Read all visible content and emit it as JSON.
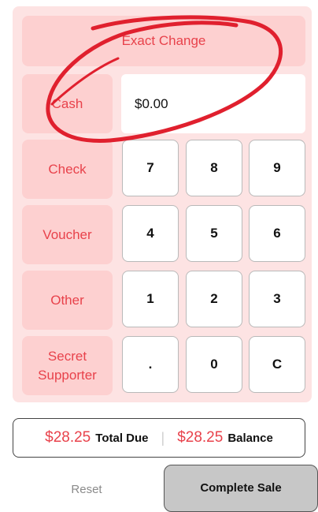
{
  "exact_change": {
    "label": "Exact Change"
  },
  "payment_methods": [
    {
      "name": "cash",
      "label": "Cash"
    },
    {
      "name": "check",
      "label": "Check"
    },
    {
      "name": "voucher",
      "label": "Voucher"
    },
    {
      "name": "other",
      "label": "Other"
    },
    {
      "name": "secret-supporter",
      "label": "Secret\nSupporter"
    }
  ],
  "amount_display": {
    "value": "$0.00"
  },
  "keypad": [
    [
      "7",
      "8",
      "9"
    ],
    [
      "4",
      "5",
      "6"
    ],
    [
      "1",
      "2",
      "3"
    ],
    [
      ".",
      "0",
      "C"
    ]
  ],
  "summary": {
    "total_due_amount": "$28.25",
    "total_due_label": "Total Due",
    "separator": "|",
    "balance_amount": "$28.25",
    "balance_label": "Balance"
  },
  "actions": {
    "reset": "Reset",
    "complete_sale": "Complete Sale"
  },
  "colors": {
    "accent": "#e8424b",
    "pill": "#fdd0d0",
    "panel": "#fde3e3",
    "annotation": "#e0202e"
  }
}
